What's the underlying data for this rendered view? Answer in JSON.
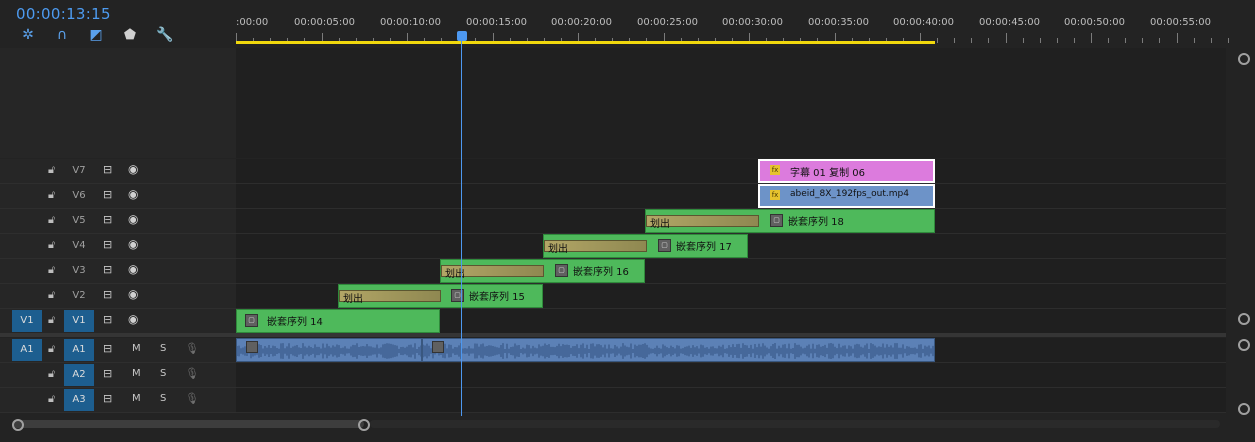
{
  "timecode": "00:00:13:15",
  "tools": [
    "snap-icon",
    "magnet-icon",
    "linked-selection-icon",
    "marker-icon",
    "wrench-icon"
  ],
  "ruler": {
    "labels": [
      ":00:00",
      "00:00:05:00",
      "00:00:10:00",
      "00:00:15:00",
      "00:00:20:00",
      "00:00:25:00",
      "00:00:30:00",
      "00:00:35:00",
      "00:00:40:00",
      "00:00:45:00",
      "00:00:50:00",
      "00:00:55:00"
    ]
  },
  "video_tracks": [
    {
      "name": "V7",
      "source": ""
    },
    {
      "name": "V6",
      "source": ""
    },
    {
      "name": "V5",
      "source": ""
    },
    {
      "name": "V4",
      "source": ""
    },
    {
      "name": "V3",
      "source": ""
    },
    {
      "name": "V2",
      "source": ""
    },
    {
      "name": "V1",
      "source": "V1"
    }
  ],
  "audio_tracks": [
    {
      "name": "A1",
      "source": "A1",
      "m": "M",
      "s": "S"
    },
    {
      "name": "A2",
      "source": "",
      "m": "M",
      "s": "S"
    },
    {
      "name": "A3",
      "source": "",
      "m": "M",
      "s": "S"
    }
  ],
  "clips": {
    "v7": "字幕 01 复制 06",
    "v6": "abeid_8X_192fps_out.mp4",
    "v5": "嵌套序列 18",
    "v4": "嵌套序列 17",
    "v3": "嵌套序列 16",
    "v2": "嵌套序列 15",
    "v1": "嵌套序列 14"
  },
  "transition_label": "划出",
  "fx_badge": "fx",
  "colors": {
    "accent": "#4d9bf0",
    "workarea": "#f1d80d",
    "clip_green": "#4eb95b"
  }
}
